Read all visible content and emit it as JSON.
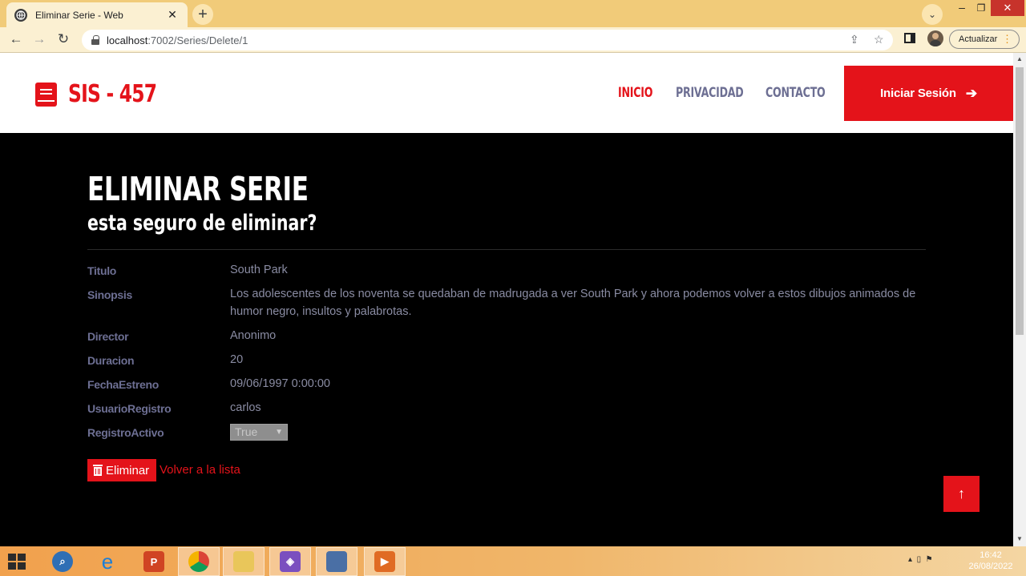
{
  "browser": {
    "tab_title": "Eliminar Serie - Web",
    "url_host": "localhost",
    "url_path": ":7002/Series/Delete/1",
    "update_label": "Actualizar"
  },
  "header": {
    "logo_text": "SIS - 457",
    "nav": [
      {
        "label": "INICIO",
        "active": true
      },
      {
        "label": "PRIVACIDAD",
        "active": false
      },
      {
        "label": "CONTACTO",
        "active": false
      }
    ],
    "login_label": "Iniciar Sesión"
  },
  "page": {
    "title": "ELIMINAR SERIE",
    "subtitle": "esta seguro de eliminar?"
  },
  "details": [
    {
      "label": "Titulo",
      "value": "South Park"
    },
    {
      "label": "Sinopsis",
      "value": "Los adolescentes de los noventa se quedaban de madrugada a ver South Park y ahora podemos volver a estos dibujos animados de humor negro, insultos y palabrotas."
    },
    {
      "label": "Director",
      "value": "Anonimo"
    },
    {
      "label": "Duracion",
      "value": "20"
    },
    {
      "label": "FechaEstreno",
      "value": "09/06/1997 0:00:00"
    },
    {
      "label": "UsuarioRegistro",
      "value": "carlos"
    },
    {
      "label": "RegistroActivo",
      "value": "True"
    }
  ],
  "actions": {
    "delete_label": "Eliminar",
    "back_label": "Volver a la lista"
  },
  "taskbar": {
    "time": "16:42",
    "date": "26/08/2022"
  },
  "colors": {
    "accent": "#e4131a",
    "nav_muted": "#6d6f93",
    "background": "#000000"
  }
}
